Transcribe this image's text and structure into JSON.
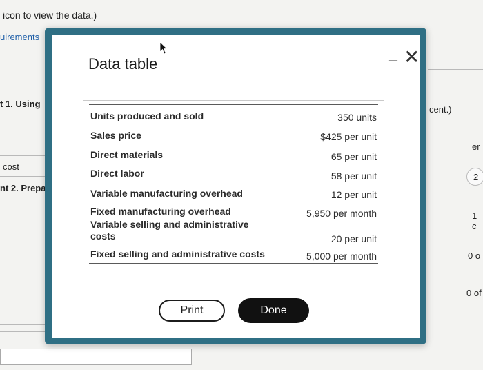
{
  "background": {
    "top_text": "icon to view the data.)",
    "requirements_link": "uirements",
    "left_labels": [
      "t 1. Using",
      "cost",
      "nt 2. Prepa"
    ],
    "right_texts": [
      "cent.)",
      "er",
      "2",
      "1 c",
      "0 o",
      "0 of"
    ]
  },
  "modal": {
    "title": "Data table",
    "minimize_label": "–",
    "close_label": "✕",
    "rows": [
      {
        "label": "Units produced and sold",
        "value": "350 units"
      },
      {
        "label": "Sales price",
        "value": "$425 per unit"
      },
      {
        "label": "Direct materials",
        "value": "65 per unit"
      },
      {
        "label": "Direct labor",
        "value": "58 per unit"
      },
      {
        "label": "Variable manufacturing overhead",
        "value": "12 per unit"
      },
      {
        "label": "Fixed manufacturing overhead",
        "value": "5,950 per month"
      },
      {
        "label": "Variable selling and administrative costs",
        "value": "20 per unit"
      },
      {
        "label": "Fixed selling and administrative costs",
        "value": "5,000 per month"
      }
    ],
    "print_label": "Print",
    "done_label": "Done"
  }
}
